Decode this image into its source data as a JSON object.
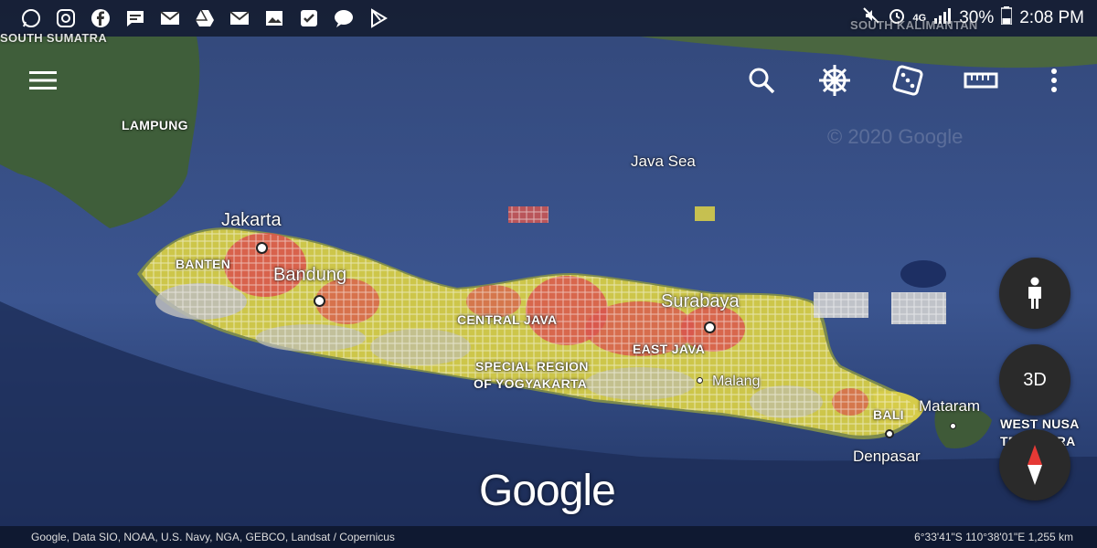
{
  "status_bar": {
    "left_icons": [
      "whatsapp-icon",
      "instagram-icon",
      "facebook-icon",
      "messages-icon",
      "gmail-icon",
      "drive-icon",
      "gmail-icon",
      "gallery-icon",
      "tasks-icon",
      "chat-icon",
      "play-store-icon"
    ],
    "network": "4G",
    "battery": "30%",
    "time": "2:08 PM"
  },
  "toolbar": {
    "menu_icon": "menu-icon",
    "search_icon": "search-icon",
    "voyager_icon": "ship-wheel-icon",
    "feeling_lucky_icon": "dice-icon",
    "measure_icon": "ruler-icon",
    "more_icon": "more-vert-icon"
  },
  "map": {
    "watermark": "© 2020 Google",
    "regions": {
      "south_sumatra": "SOUTH SUMATRA",
      "lampung": "LAMPUNG",
      "banten": "BANTEN",
      "central_java": "CENTRAL JAVA",
      "yogyakarta_1": "SPECIAL REGION",
      "yogyakarta_2": "OF YOGYAKARTA",
      "east_java": "EAST JAVA",
      "bali": "BALI",
      "west_nusa_1": "WEST NUSA",
      "west_nusa_2": "TENGGARA",
      "kalimantan": "SOUTH KALIMANTAN"
    },
    "cities": {
      "jakarta": "Jakarta",
      "bandung": "Bandung",
      "surabaya": "Surabaya",
      "malang": "Malang",
      "mataram": "Mataram",
      "denpasar": "Denpasar"
    },
    "sea": "Java Sea",
    "heat_colors": {
      "high": "#e0524a",
      "mid": "#d9cf4a",
      "low": "#cfcfcf"
    }
  },
  "controls": {
    "pegman_icon": "pegman-icon",
    "three_d": "3D",
    "compass_icon": "compass-icon"
  },
  "logo": "Google",
  "footer": {
    "attribution": "Google, Data SIO, NOAA, U.S. Navy, NGA, GEBCO, Landsat / Copernicus",
    "coordinates": "6°33'41\"S 110°38'01\"E 1,255 km"
  }
}
